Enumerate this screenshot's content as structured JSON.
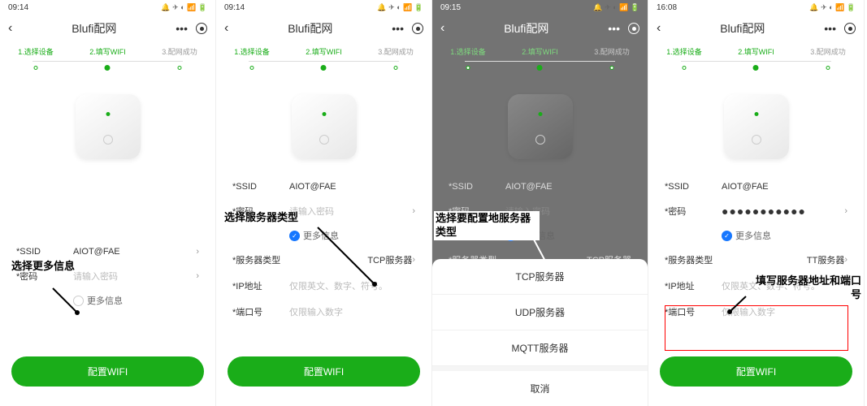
{
  "screens": [
    {
      "time": "09:14",
      "title": "Blufi配网",
      "steps": [
        "1.选择设备",
        "2.填写WIFI",
        "3.配网成功"
      ],
      "ssid_label": "*SSID",
      "ssid_value": "AIOT@FAE",
      "pwd_label": "*密码",
      "pwd_placeholder": "请输入密码",
      "more_info": "更多信息",
      "button": "配置WIFI",
      "annotation": "选择更多信息"
    },
    {
      "time": "09:14",
      "title": "Blufi配网",
      "steps": [
        "1.选择设备",
        "2.填写WIFI",
        "3.配网成功"
      ],
      "ssid_label": "*SSID",
      "ssid_value": "AIOT@FAE",
      "pwd_label": "*密码",
      "pwd_placeholder": "请输入密码",
      "more_info": "更多信息",
      "server_type_label": "*服务器类型",
      "server_type_value": "TCP服务器",
      "ip_label": "*IP地址",
      "ip_placeholder": "仅限英文、数字、符号。",
      "port_label": "*端口号",
      "port_placeholder": "仅限输入数字",
      "button": "配置WIFI",
      "annotation": "选择服务器类型"
    },
    {
      "time": "09:15",
      "title": "Blufi配网",
      "steps": [
        "1.选择设备",
        "2.填写WIFI",
        "3.配网成功"
      ],
      "ssid_label": "*SSID",
      "ssid_value": "AIOT@FAE",
      "pwd_label": "*密码",
      "pwd_placeholder": "请输入密码",
      "more_info": "更多信息",
      "server_type_label": "*服务器类型",
      "server_type_value": "TCP服务器",
      "sheet_options": [
        "TCP服务器",
        "UDP服务器",
        "MQTT服务器"
      ],
      "sheet_cancel": "取消",
      "annotation": "选择要配置地服务器类型"
    },
    {
      "time": "16:08",
      "title": "Blufi配网",
      "steps": [
        "1.选择设备",
        "2.填写WIFI",
        "3.配网成功"
      ],
      "ssid_label": "*SSID",
      "ssid_value": "AIOT@FAE",
      "pwd_label": "*密码",
      "pwd_value": "●●●●●●●●●●●",
      "more_info": "更多信息",
      "server_type_label": "*服务器类型",
      "server_type_value": "TT服务器",
      "ip_label": "*IP地址",
      "ip_placeholder": "仅限英文、数字、符号。",
      "port_label": "*端口号",
      "port_placeholder": "仅限输入数字",
      "button": "配置WIFI",
      "annotation": "填写服务器地址和端口号"
    }
  ]
}
